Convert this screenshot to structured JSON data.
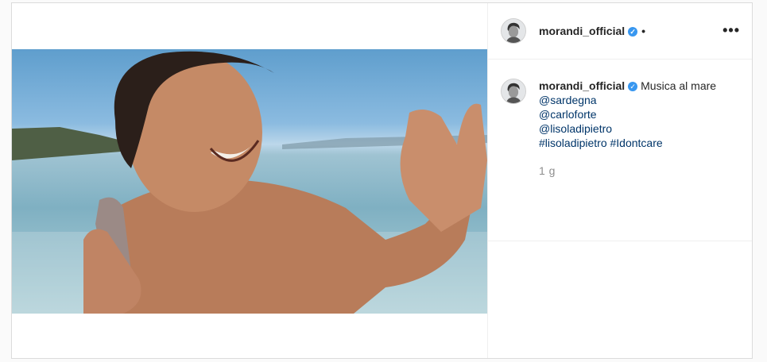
{
  "post": {
    "username": "morandi_official",
    "verified_glyph": "✓",
    "dot": "•",
    "more_icon": "•••",
    "caption": {
      "username": "morandi_official",
      "text": "Musica al mare",
      "mentions": [
        "@sardegna",
        "@carloforte",
        "@lisoladipietro"
      ],
      "hashtags": "#lisoladipietro #Idontcare"
    },
    "timestamp": "1 g"
  }
}
